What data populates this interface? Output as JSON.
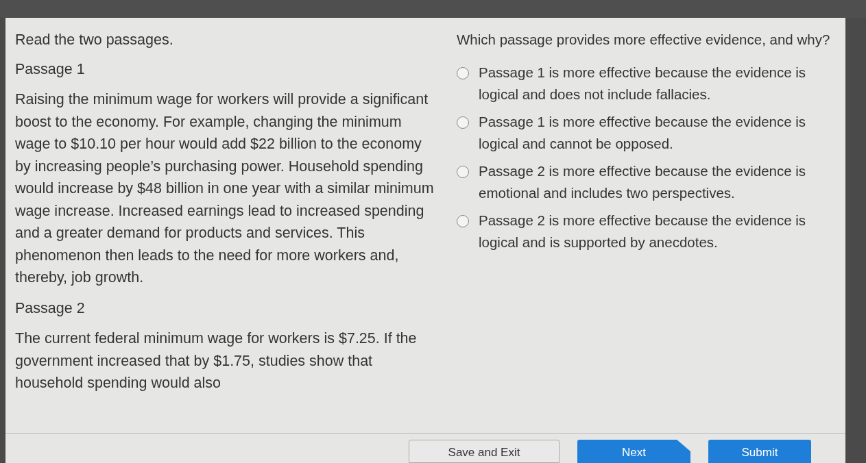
{
  "instructions": "Read the two passages.",
  "passages": [
    {
      "heading": "Passage 1",
      "text": "Raising the minimum wage for workers will provide a significant boost to the economy. For example, changing the minimum wage to $10.10 per hour would add $22 billion to the economy by increasing people’s purchasing power. Household spending would increase by $48 billion in one year with a similar minimum wage increase. Increased earnings lead to increased spending and a greater demand for products and services. This phenomenon then leads to the need for more workers and, thereby, job growth."
    },
    {
      "heading": "Passage 2",
      "text": "The current federal minimum wage for workers is $7.25. If the government increased that by $1.75, studies show that household spending would also"
    }
  ],
  "question": "Which passage provides more effective evidence, and why?",
  "options": [
    {
      "label": "Passage 1 is more effective because the evidence is logical and does not include fallacies.",
      "selected": false
    },
    {
      "label": "Passage 1 is more effective because the evidence is logical and cannot be opposed.",
      "selected": false
    },
    {
      "label": "Passage 2 is more effective because the evidence is emotional and includes two perspectives.",
      "selected": false
    },
    {
      "label": "Passage 2 is more effective because the evidence is logical and is supported by anecdotes.",
      "selected": false
    }
  ],
  "buttons": [
    {
      "label": "Save and Exit",
      "kind": "secondary"
    },
    {
      "label": "Next",
      "kind": "next"
    },
    {
      "label": "Submit",
      "kind": "primary"
    }
  ]
}
